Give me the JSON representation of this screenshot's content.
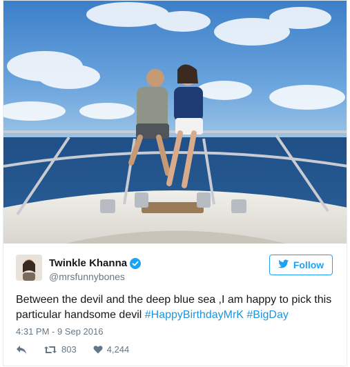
{
  "user": {
    "display_name": "Twinkle Khanna",
    "handle": "@mrsfunnybones",
    "verified": true
  },
  "follow_button": {
    "label": "Follow",
    "icon": "twitter-bird-icon"
  },
  "tweet": {
    "text": "Between the devil and the deep blue sea ,I am happy to pick this particular handsome devil",
    "hashtags": [
      "#HappyBirthdayMrK",
      "#BigDay"
    ],
    "timestamp": "4:31 PM - 9 Sep 2016"
  },
  "actions": {
    "reply_icon": "reply-icon",
    "retweet_icon": "retweet-icon",
    "retweet_count": "803",
    "like_icon": "heart-icon",
    "like_count": "4,244"
  },
  "colors": {
    "accent": "#1da1f2",
    "hashtag": "#1b95e0",
    "text": "#14171a",
    "muted": "#657786"
  }
}
